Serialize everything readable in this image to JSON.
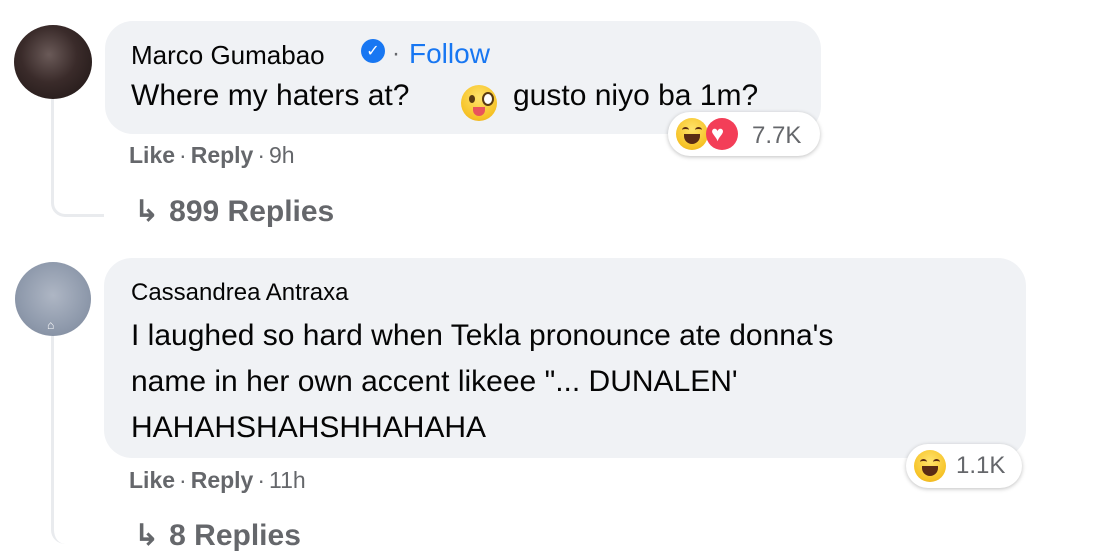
{
  "comments": [
    {
      "author": "Marco Gumabao",
      "verified_icon": "verified-badge-icon",
      "separator": "·",
      "follow_label": "Follow",
      "text_before": "Where my haters at?",
      "inline_emoji": "zany-face-emoji-icon",
      "text_after": "gusto niyo ba 1m?",
      "reactions": [
        "haha-reaction-icon",
        "love-reaction-icon"
      ],
      "reaction_count": "7.7K",
      "like_label": "Like",
      "reply_label": "Reply",
      "time": "9h",
      "replies_label": "899 Replies"
    },
    {
      "author": "Cassandrea Antraxa",
      "text_lines": [
        "I laughed so hard when Tekla pronounce ate donna's",
        "name in her own accent likeee \"... DUNALEN'",
        "HAHAHSHAHSHHAHAHA"
      ],
      "reactions": [
        "haha-reaction-icon"
      ],
      "reaction_count": "1.1K",
      "like_label": "Like",
      "reply_label": "Reply",
      "time": "11h",
      "replies_label": "8 Replies"
    }
  ],
  "colors": {
    "bubble": "#f0f2f5",
    "link_blue": "#1877f2",
    "meta_gray": "#65676b",
    "love_red": "#f33e58",
    "haha_yellow": "#f6c226"
  },
  "separator_dot": "·"
}
